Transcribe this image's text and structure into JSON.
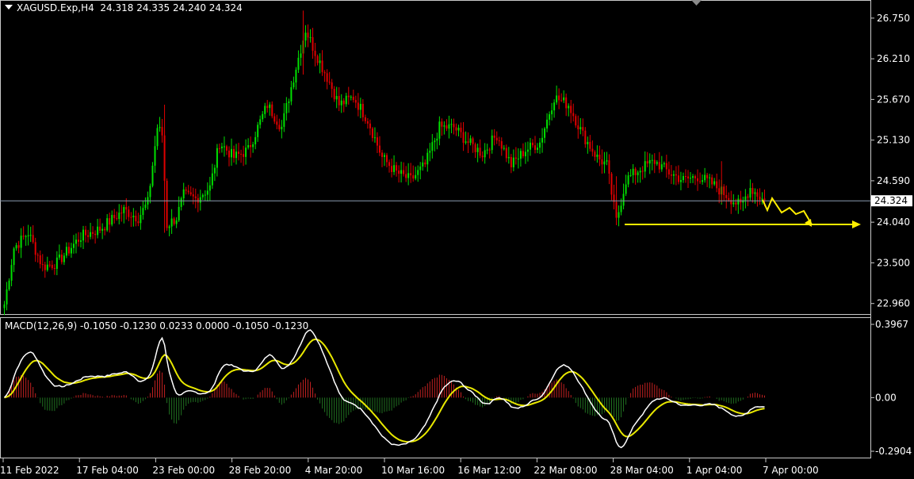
{
  "header": {
    "symbol": "XAGUSD.Exp,H4",
    "ohlc": "24.318 24.335 24.240 24.324"
  },
  "macd": {
    "label": "MACD(12,26,9) -0.1050 -0.1230 0.0233 0.0000 -0.1050 -0.1230",
    "ticks": [
      "0.3967",
      "0.00",
      "-0.2904"
    ],
    "tick_values": [
      0.3967,
      0.0,
      -0.2904
    ]
  },
  "colors": {
    "background": "#000000",
    "bull": "#00e000",
    "bear": "#e00000",
    "macd_line": "#ffffff",
    "signal_line": "#e8e800",
    "hist_pos": "#c02020",
    "hist_neg": "#207020",
    "annotation": "#ffee00",
    "current_price_line": "#8a9bb0"
  },
  "chart_data": {
    "type": "candlestick",
    "x_ticks": [
      "11 Feb 2022",
      "17 Feb 04:00",
      "23 Feb 00:00",
      "28 Feb 20:00",
      "4 Mar 20:00",
      "10 Mar 16:00",
      "16 Mar 12:00",
      "22 Mar 08:00",
      "28 Mar 04:00",
      "1 Apr 04:00",
      "7 Apr 00:00"
    ],
    "y_ticks": [
      26.75,
      26.21,
      25.67,
      25.13,
      24.59,
      24.04,
      23.5,
      22.96
    ],
    "y_tick_labels": [
      "26.750",
      "26.210",
      "25.670",
      "25.130",
      "24.590",
      "24.040",
      "23.500",
      "22.960"
    ],
    "ylim": [
      22.82,
      26.98
    ],
    "current_price": 24.324,
    "current_price_label": "24.324",
    "support_level": 24.01,
    "price_anchors": [
      [
        0,
        22.95
      ],
      [
        4,
        23.7
      ],
      [
        10,
        23.9
      ],
      [
        16,
        23.45
      ],
      [
        22,
        23.5
      ],
      [
        32,
        23.85
      ],
      [
        40,
        23.95
      ],
      [
        50,
        24.2
      ],
      [
        56,
        24.1
      ],
      [
        60,
        24.3
      ],
      [
        64,
        25.3
      ],
      [
        66,
        25.2
      ],
      [
        68,
        24.0
      ],
      [
        72,
        24.1
      ],
      [
        75,
        24.4
      ],
      [
        80,
        24.35
      ],
      [
        86,
        24.5
      ],
      [
        90,
        25.1
      ],
      [
        96,
        24.9
      ],
      [
        102,
        25.0
      ],
      [
        110,
        25.6
      ],
      [
        116,
        25.3
      ],
      [
        122,
        26.1
      ],
      [
        126,
        26.6
      ],
      [
        130,
        26.3
      ],
      [
        136,
        25.9
      ],
      [
        140,
        25.6
      ],
      [
        146,
        25.7
      ],
      [
        152,
        25.4
      ],
      [
        158,
        24.9
      ],
      [
        164,
        24.7
      ],
      [
        170,
        24.6
      ],
      [
        176,
        24.8
      ],
      [
        182,
        25.3
      ],
      [
        188,
        25.3
      ],
      [
        194,
        25.1
      ],
      [
        200,
        24.95
      ],
      [
        206,
        25.2
      ],
      [
        212,
        24.8
      ],
      [
        218,
        25.0
      ],
      [
        224,
        25.1
      ],
      [
        230,
        25.7
      ],
      [
        236,
        25.6
      ],
      [
        242,
        25.2
      ],
      [
        248,
        24.9
      ],
      [
        252,
        24.8
      ],
      [
        256,
        24.05
      ],
      [
        260,
        24.6
      ],
      [
        266,
        24.75
      ],
      [
        272,
        24.85
      ],
      [
        278,
        24.7
      ],
      [
        284,
        24.6
      ],
      [
        290,
        24.65
      ],
      [
        296,
        24.55
      ],
      [
        300,
        24.45
      ],
      [
        304,
        24.35
      ],
      [
        308,
        24.25
      ],
      [
        312,
        24.5
      ],
      [
        318,
        24.32
      ]
    ],
    "candle_count": 319
  }
}
